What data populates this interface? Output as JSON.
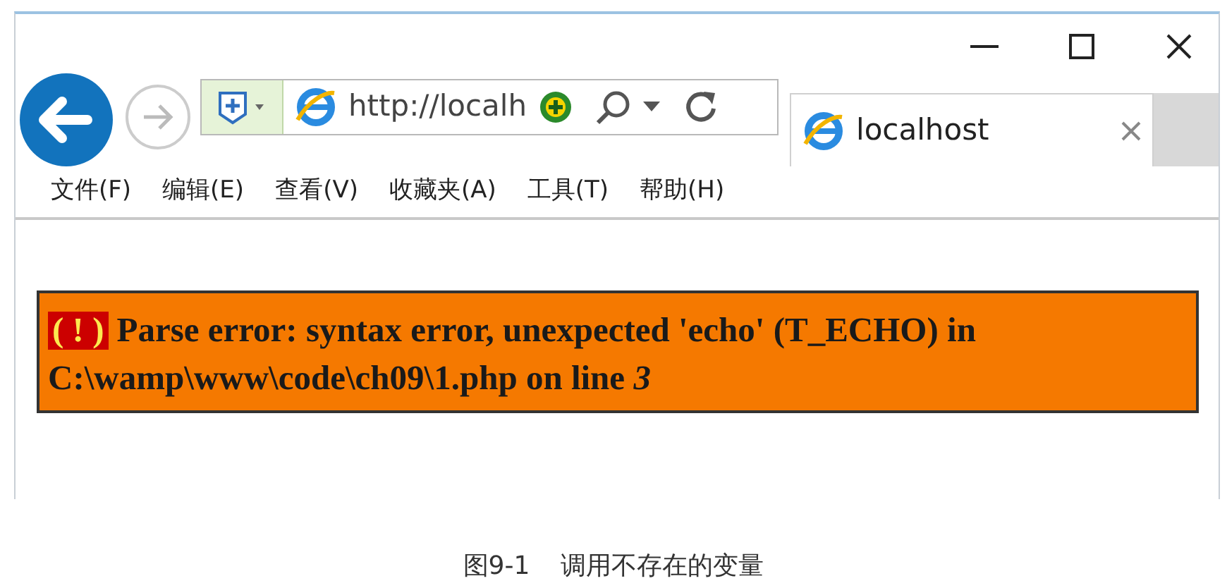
{
  "address_bar": {
    "url": "http://localh"
  },
  "tab": {
    "title": "localhost"
  },
  "menu": [
    "文件(F)",
    "编辑(E)",
    "查看(V)",
    "收藏夹(A)",
    "工具(T)",
    "帮助(H)"
  ],
  "error": {
    "marker": "( ! )",
    "message": "Parse error: syntax error, unexpected 'echo' (T_ECHO) in C:\\wamp\\www\\code\\ch09\\1.php on line *3*"
  },
  "caption": {
    "figure": "图9-1",
    "title": "调用不存在的变量"
  }
}
